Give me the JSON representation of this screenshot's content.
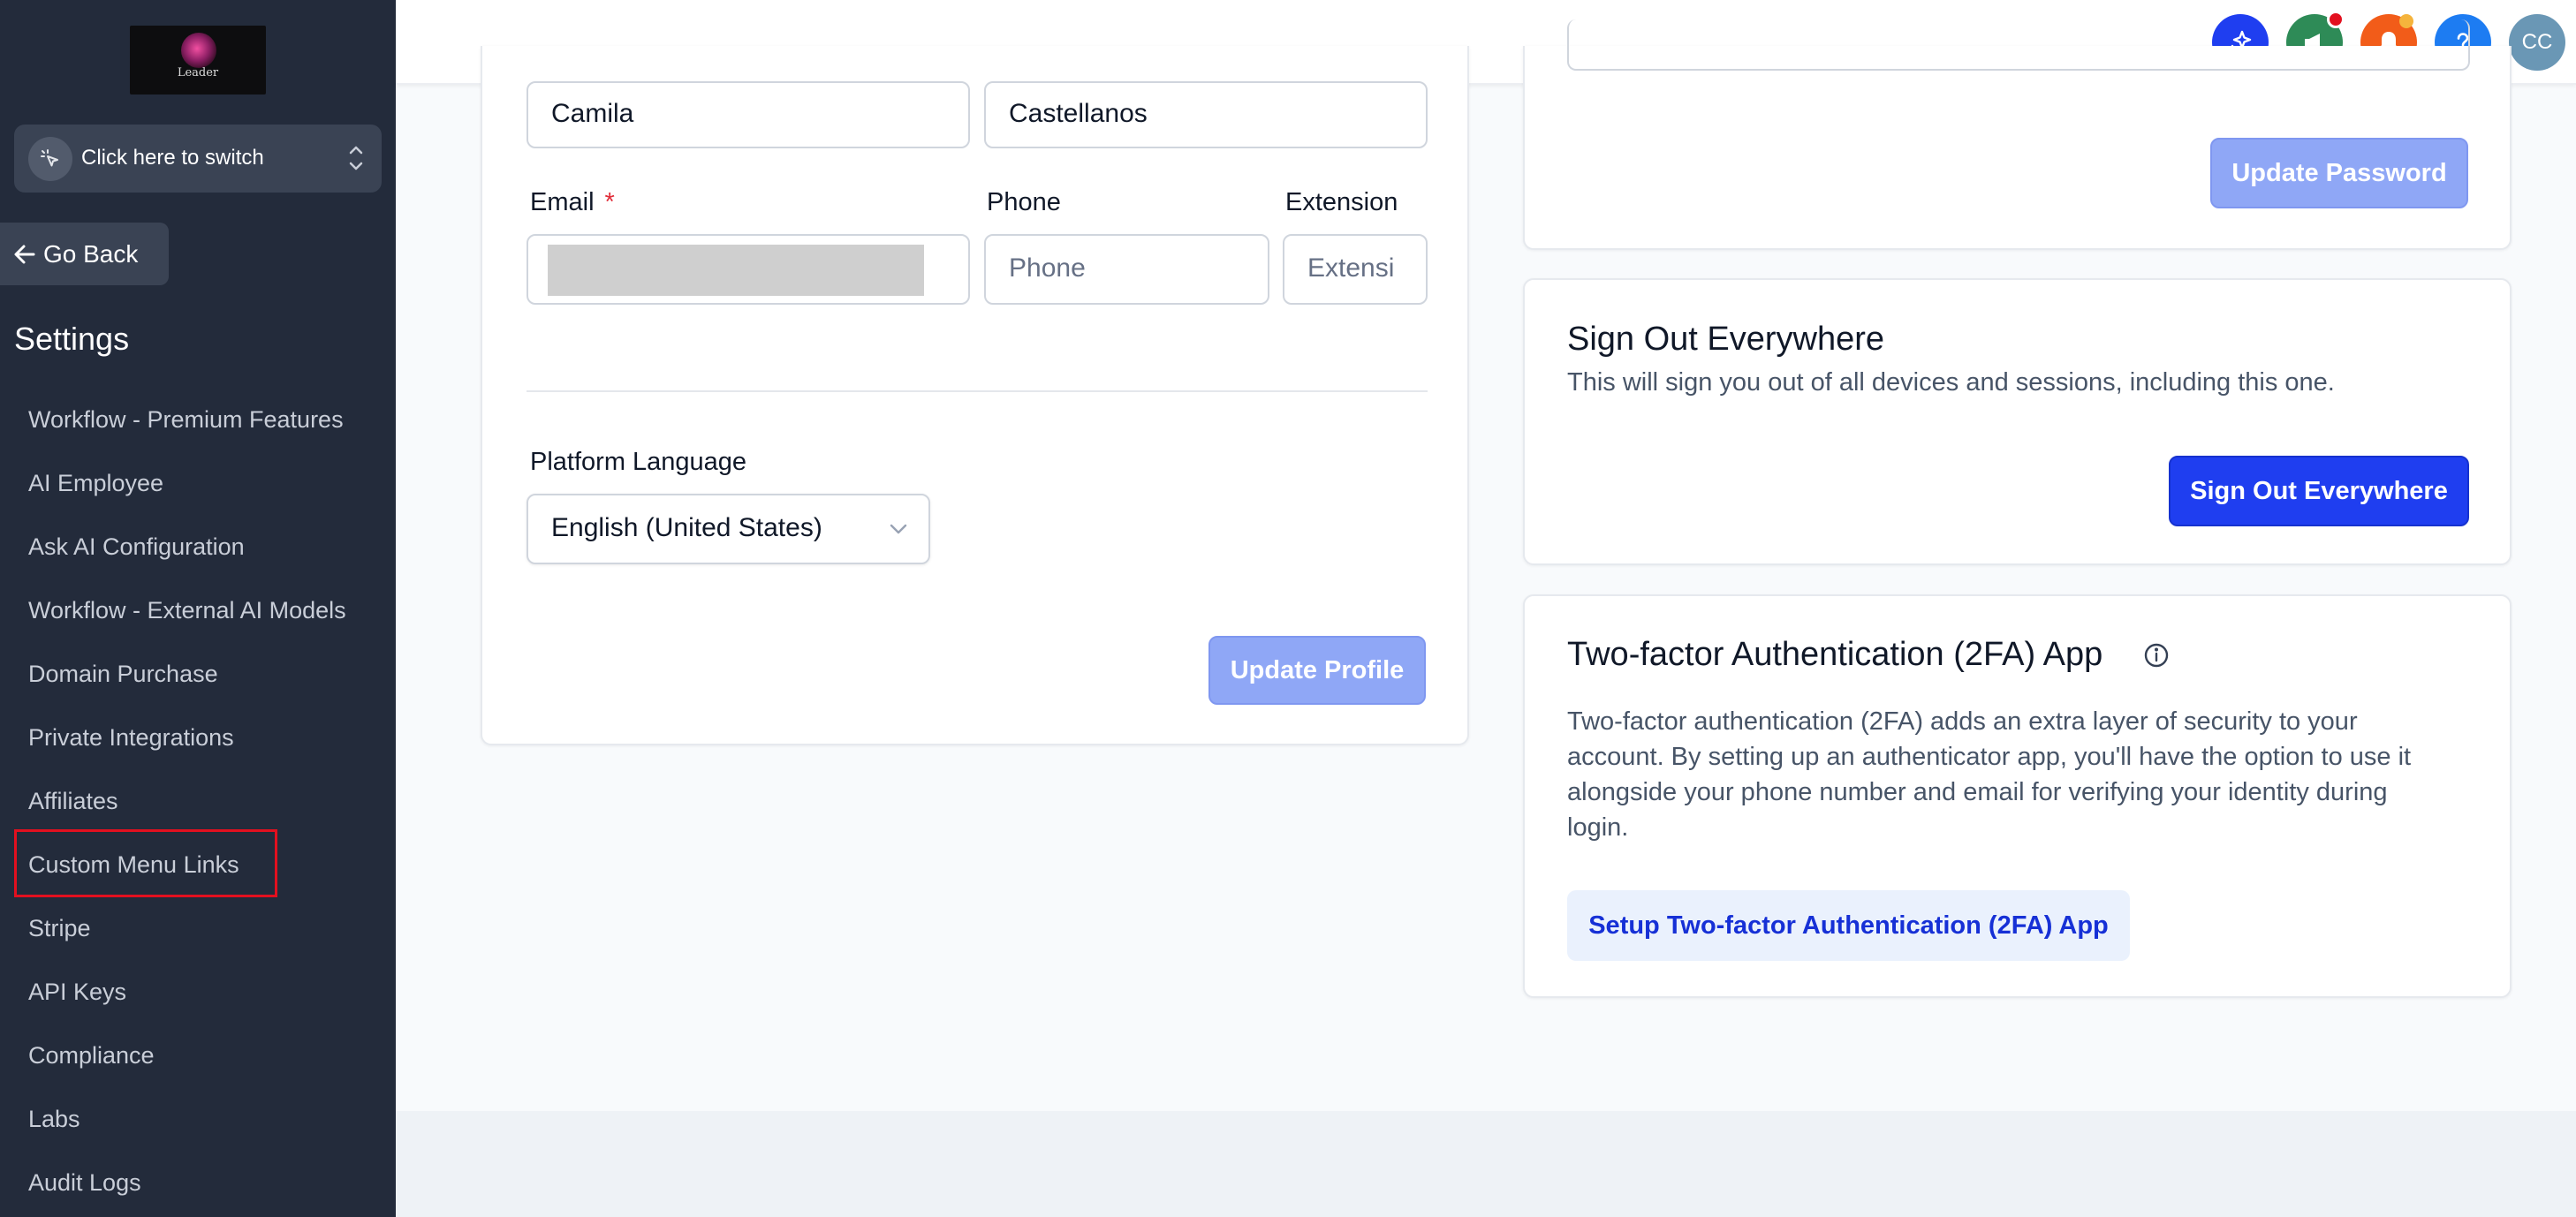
{
  "sidebar": {
    "logo_text": "Leader",
    "switcher_label": "Click here to switch",
    "go_back_label": "Go Back",
    "section_title": "Settings",
    "items": [
      {
        "label": "Workflow - Premium Features"
      },
      {
        "label": "AI Employee"
      },
      {
        "label": "Ask AI Configuration"
      },
      {
        "label": "Workflow - External AI Models"
      },
      {
        "label": "Domain Purchase"
      },
      {
        "label": "Private Integrations"
      },
      {
        "label": "Affiliates"
      },
      {
        "label": "Custom Menu Links"
      },
      {
        "label": "Stripe"
      },
      {
        "label": "API Keys"
      },
      {
        "label": "Compliance"
      },
      {
        "label": "Labs"
      },
      {
        "label": "Audit Logs"
      }
    ],
    "highlighted_item": "Custom Menu Links"
  },
  "topbar": {
    "icons": [
      "ai-sparkle-icon",
      "megaphone-icon",
      "bell-icon",
      "help-icon"
    ],
    "avatar_initials": "CC",
    "colors": {
      "ai": "#1f3ef0",
      "announcements": "#2e8b57",
      "notifications": "#f25c19",
      "help": "#1d7cf2",
      "avatar": "#6a97b5"
    }
  },
  "profile": {
    "first_name_value": "Camila",
    "last_name_value": "Castellanos",
    "email_label": "Email",
    "email_required_mark": "*",
    "phone_label": "Phone",
    "phone_placeholder": "Phone",
    "extension_label": "Extension",
    "extension_placeholder": "Extensi",
    "language_label": "Platform Language",
    "language_value": "English (United States)",
    "update_button": "Update Profile"
  },
  "password": {
    "update_button": "Update Password"
  },
  "signout": {
    "title": "Sign Out Everywhere",
    "description": "This will sign you out of all devices and sessions, including this one.",
    "button": "Sign Out Everywhere"
  },
  "twofa": {
    "title": "Two-factor Authentication (2FA) App",
    "description": "Two-factor authentication (2FA) adds an extra layer of security to your account. By setting up an authenticator app, you'll have the option to use it alongside your phone number and email for verifying your identity during login.",
    "button": "Setup Two-factor Authentication (2FA) App"
  }
}
